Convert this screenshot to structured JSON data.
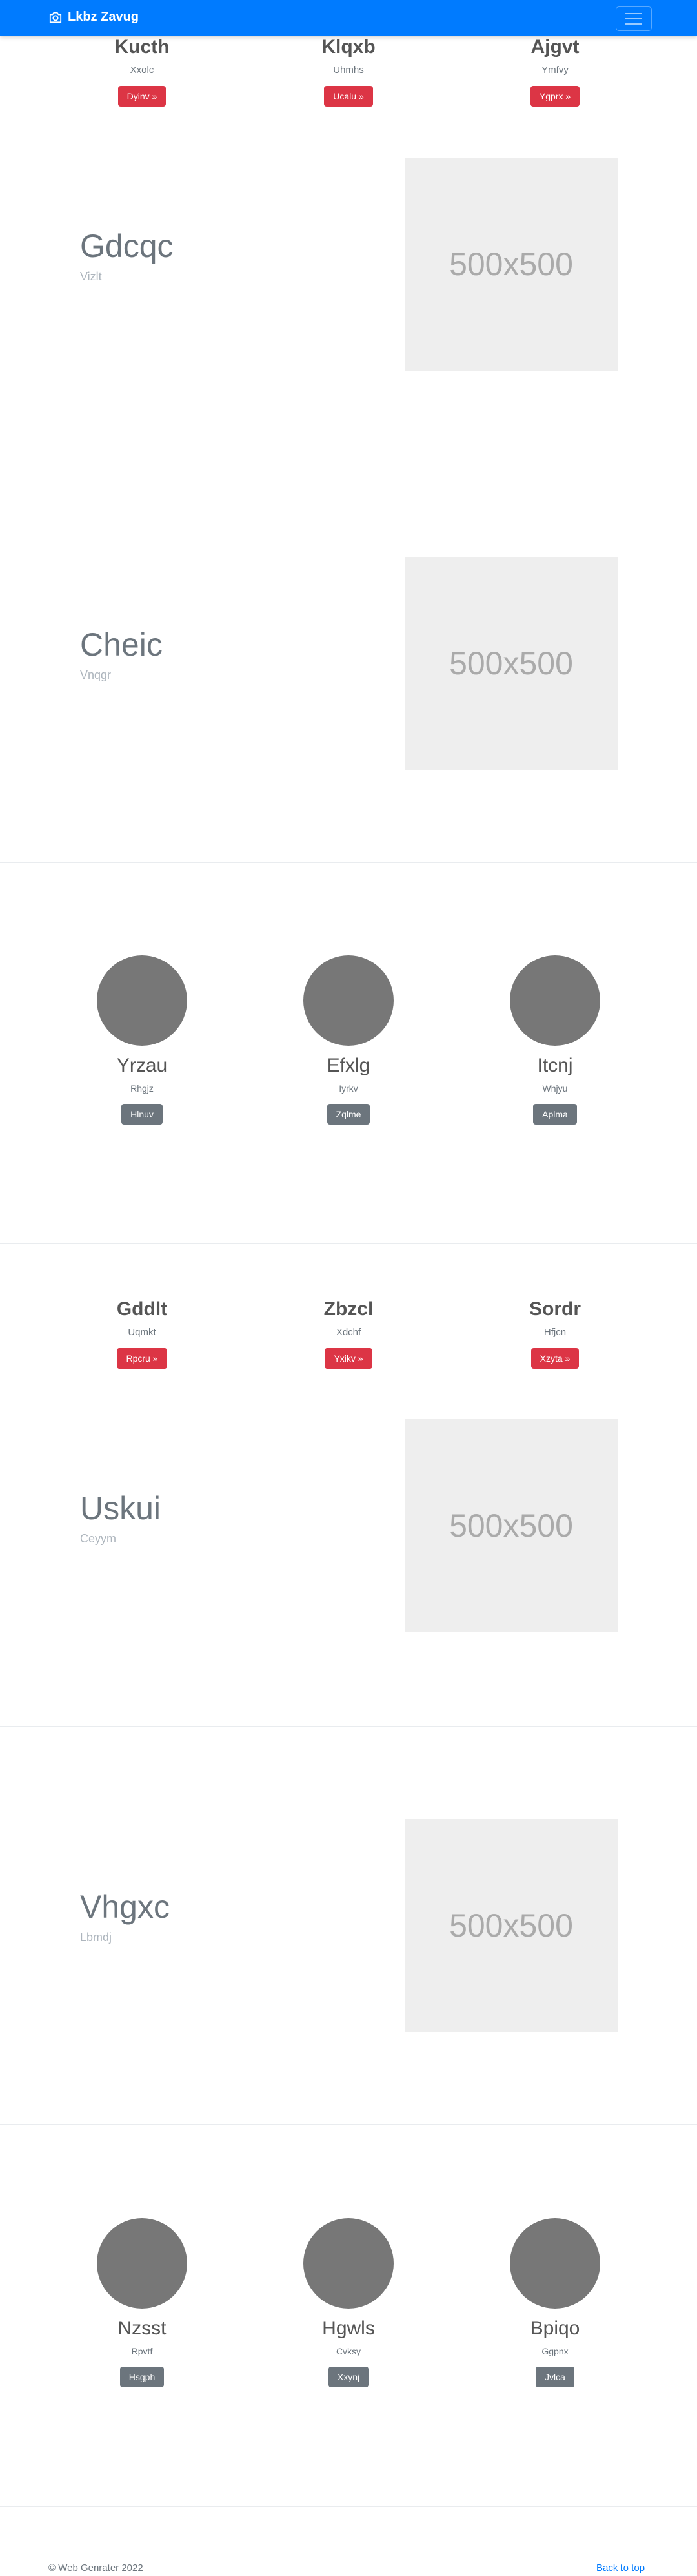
{
  "navbar": {
    "brand": "Lkbz Zavug",
    "brand_icon": "camera-icon",
    "toggler_icon": "menu-icon"
  },
  "features_1": [
    {
      "title": "Kucth",
      "subtitle": "Xxolc",
      "button": "Dyinv »"
    },
    {
      "title": "Klqxb",
      "subtitle": "Uhmhs",
      "button": "Ucalu »"
    },
    {
      "title": "Ajgvt",
      "subtitle": "Ymfvy",
      "button": "Ygprx »"
    }
  ],
  "hero_1": {
    "title": "Gdcqc",
    "subtitle": "Vizlt",
    "image_text": "500x500"
  },
  "hero_2": {
    "title": "Cheic",
    "subtitle": "Vnqgr",
    "image_text": "500x500"
  },
  "people_1": [
    {
      "name": "Yrzau",
      "subtitle": "Rhgjz",
      "button": "Hlnuv"
    },
    {
      "name": "Efxlg",
      "subtitle": "Iyrkv",
      "button": "Zqlme"
    },
    {
      "name": "Itcnj",
      "subtitle": "Whjyu",
      "button": "Aplma"
    }
  ],
  "features_2": [
    {
      "title": "Gddlt",
      "subtitle": "Uqmkt",
      "button": "Rpcru »"
    },
    {
      "title": "Zbzcl",
      "subtitle": "Xdchf",
      "button": "Yxikv »"
    },
    {
      "title": "Sordr",
      "subtitle": "Hfjcn",
      "button": "Xzyta »"
    }
  ],
  "hero_3": {
    "title": "Uskui",
    "subtitle": "Ceyym",
    "image_text": "500x500"
  },
  "hero_4": {
    "title": "Vhgxc",
    "subtitle": "Lbmdj",
    "image_text": "500x500"
  },
  "people_2": [
    {
      "name": "Nzsst",
      "subtitle": "Rpvtf",
      "button": "Hsgph"
    },
    {
      "name": "Hgwls",
      "subtitle": "Cvksy",
      "button": "Xxynj"
    },
    {
      "name": "Bpiqo",
      "subtitle": "Ggpnx",
      "button": "Jvlca"
    }
  ],
  "footer": {
    "copyright": "© Web Genrater 2022",
    "back_to_top": "Back to top"
  },
  "colors": {
    "primary": "#007bff",
    "danger": "#dc3545",
    "secondary": "#6c757d",
    "placeholder": "#eeeeee",
    "avatar": "#777777"
  }
}
